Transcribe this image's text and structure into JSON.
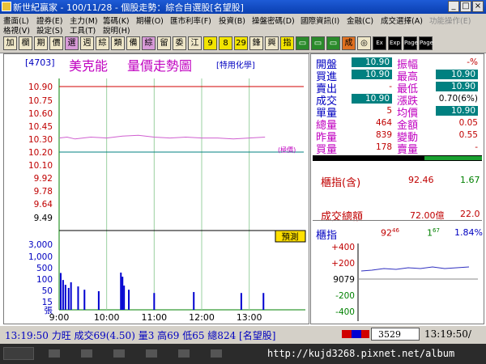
{
  "window": {
    "title": "新世紀贏家 - 100/11/28 - 個股走勢：綜合自選股[名望股]",
    "buttons": [
      "_",
      "□",
      "×"
    ]
  },
  "menu": {
    "row1": [
      "畫面(L)",
      "證券(E)",
      "主力(M)",
      "籌碼(K)",
      "期權(O)",
      "匯市利率(F)",
      "投資(B)",
      "操盤密碼(D)",
      "國際資訊(I)",
      "金融(C)",
      "成交選擇(A)",
      "功能操作(E)"
    ],
    "row1_dim": [
      false,
      false,
      false,
      false,
      false,
      false,
      false,
      false,
      false,
      false,
      false,
      true
    ],
    "row2": [
      "格視(V)",
      "設定(S)",
      "工具(T)",
      "說明(H)"
    ]
  },
  "toolbar": {
    "items": [
      "加",
      "欄",
      "期",
      "價",
      "選",
      "週",
      "綜",
      "類",
      "備",
      "綜",
      "留",
      "委",
      "江",
      "9",
      "8",
      "29",
      "鋒",
      "興",
      "指",
      "▭",
      "▭",
      "▭",
      "成",
      "◎",
      "Ex",
      "Exp",
      "Page",
      "Page"
    ]
  },
  "chart": {
    "stock_code": "[4703]",
    "stock_name": "美克能",
    "chart_title": "量價走勢圖",
    "category": "[特用化學]",
    "limit_up_label": "(極價)",
    "avg_label": "(極價)",
    "special_label": "預測"
  },
  "chart_data": {
    "type": "line",
    "price_ticks": [
      "10.90",
      "10.75",
      "10.60",
      "10.45",
      "10.30",
      "10.20",
      "10.10",
      "9.92",
      "9.78",
      "9.64",
      "9.49"
    ],
    "price_tick_colors": [
      "#c00000",
      "#c00000",
      "#c00000",
      "#c00000",
      "#c00000",
      "#c00000",
      "#c00000",
      "#c00000",
      "#c00000",
      "#c00000",
      "#000000"
    ],
    "volume_ticks": [
      "3,000",
      "1,000",
      "500",
      "100",
      "50",
      "15"
    ],
    "volume_unit": "張",
    "time_ticks": [
      "9:00",
      "10:00",
      "11:00",
      "12:00",
      "13:00"
    ],
    "ylim": [
      9.49,
      10.9
    ],
    "reference_price": 10.2,
    "price_series": [
      {
        "t": 0,
        "p": 10.35
      },
      {
        "t": 10,
        "p": 10.36
      },
      {
        "t": 20,
        "p": 10.34
      },
      {
        "t": 40,
        "p": 10.36
      },
      {
        "t": 60,
        "p": 10.35
      },
      {
        "t": 80,
        "p": 10.37
      },
      {
        "t": 100,
        "p": 10.38
      },
      {
        "t": 120,
        "p": 10.36
      },
      {
        "t": 140,
        "p": 10.35
      },
      {
        "t": 160,
        "p": 10.36
      },
      {
        "t": 180,
        "p": 10.35
      },
      {
        "t": 200,
        "p": 10.35
      },
      {
        "t": 220,
        "p": 10.34
      },
      {
        "t": 240,
        "p": 10.35
      },
      {
        "t": 260,
        "p": 10.36
      }
    ],
    "volume_series": [
      {
        "t": 2,
        "v": 95
      },
      {
        "t": 5,
        "v": 40
      },
      {
        "t": 8,
        "v": 22
      },
      {
        "t": 12,
        "v": 15
      },
      {
        "t": 15,
        "v": 30
      },
      {
        "t": 24,
        "v": 18
      },
      {
        "t": 32,
        "v": 12
      },
      {
        "t": 50,
        "v": 10
      },
      {
        "t": 78,
        "v": 100
      },
      {
        "t": 80,
        "v": 60
      },
      {
        "t": 82,
        "v": 20
      },
      {
        "t": 88,
        "v": 12
      },
      {
        "t": 120,
        "v": 8
      },
      {
        "t": 170,
        "v": 9
      },
      {
        "t": 230,
        "v": 8
      },
      {
        "t": 258,
        "v": 8
      }
    ]
  },
  "quote": {
    "rows": [
      {
        "l1": "開盤",
        "v1": "10.90",
        "v1_box": true,
        "l2": "振幅",
        "v2": "-%",
        "v2_box": false
      },
      {
        "l1": "買進",
        "v1": "10.90",
        "v1_box": true,
        "l2": "最高",
        "v2": "10.90",
        "v2_box": true
      },
      {
        "l1": "賣出",
        "v1": "-",
        "v1_box": false,
        "l2": "最低",
        "v2": "10.90",
        "v2_box": true
      },
      {
        "l1": "成交",
        "v1": "10.90",
        "v1_box": true,
        "l2": "漲跌",
        "v2": "0.70(6%)",
        "v2_box": false
      },
      {
        "l1": "單量",
        "v1": "5",
        "v1_box": false,
        "l2": "均價",
        "v2": "10.90",
        "v2_box": true
      },
      {
        "l1": "總量",
        "v1": "464",
        "v1_box": false,
        "l2": "金額",
        "v2": "0.05",
        "v2_box": false
      },
      {
        "l1": "昨量",
        "v1": "839",
        "v1_box": false,
        "l2": "變動",
        "v2": "0.55",
        "v2_box": false
      },
      {
        "l1": "買量",
        "v1": "178",
        "v1_box": false,
        "l2": "賣量",
        "v2": "-",
        "v2_box": false
      }
    ],
    "index_label": "櫃指(含)",
    "index_value": "92.46",
    "index_change": "1.67",
    "total_label": "成交總額",
    "total_value": "72.00億",
    "total_extra": "22.0"
  },
  "mini_chart": {
    "label": "櫃指",
    "value_main": "92",
    "value_frac": "46",
    "change_main": "1",
    "change_frac": "67",
    "pct": "1.84%",
    "ticks": [
      "+400",
      "+200",
      "9079",
      "-200",
      "-400"
    ]
  },
  "status": {
    "text": "13:19:50 力旺 成交69(4.50) 量3 高69 低65 總824 [名望股]",
    "quote_box": "3529",
    "clock": "13:19:50/"
  },
  "taskbar": {
    "url": "http://kujd3268.pixnet.net/album"
  }
}
